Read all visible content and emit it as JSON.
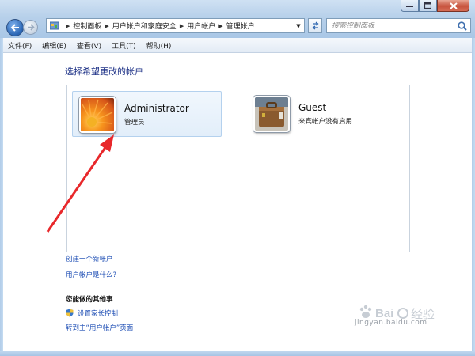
{
  "window": {
    "breadcrumbs": [
      "控制面板",
      "用户帐户和家庭安全",
      "用户帐户",
      "管理帐户"
    ],
    "search_placeholder": "搜索控制面板"
  },
  "menu": [
    "文件(F)",
    "编辑(E)",
    "查看(V)",
    "工具(T)",
    "帮助(H)"
  ],
  "main": {
    "heading": "选择希望更改的帐户",
    "accounts": [
      {
        "name": "Administrator",
        "type": "管理员",
        "avatar": "orange-flower-image",
        "selected": true
      },
      {
        "name": "Guest",
        "type": "来宾帐户没有启用",
        "avatar": "suitcase-image",
        "selected": false
      }
    ],
    "links": [
      "创建一个新帐户",
      "用户帐户是什么?"
    ],
    "other_heading": "您能做的其他事",
    "other_links": [
      "设置家长控制",
      "转到主“用户帐户”页面"
    ]
  },
  "watermark": {
    "site": "jingyan.baidu.com"
  },
  "colors": {
    "link": "#1f4fb5",
    "heading": "#1e3287",
    "annotation_arrow": "#e8282b"
  }
}
